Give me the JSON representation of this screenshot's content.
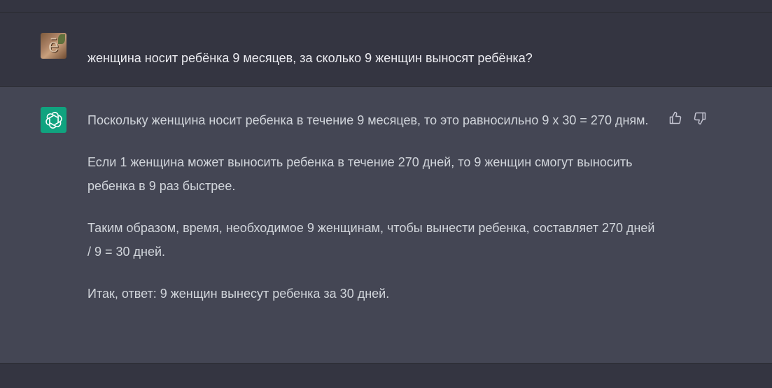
{
  "conversation": {
    "user_message": {
      "avatar": "user-photo-avatar",
      "avatar_glyph": "ē",
      "text": "женщина носит ребёнка 9 месяцев, за сколько 9 женщин выносят ребёнка?"
    },
    "assistant_message": {
      "avatar": "chatgpt-logo-icon",
      "avatar_color": "#10a37f",
      "paragraphs": [
        "Поскольку женщина носит ребенка в течение 9 месяцев, то это равносильно 9 x 30 = 270 дням.",
        "Если 1 женщина может выносить ребенка в течение 270 дней, то 9 женщин смогут выносить ребенка в 9 раз быстрее.",
        "Таким образом, время, необходимое 9 женщинам, чтобы вынести ребенка, составляет 270 дней / 9 = 30 дней.",
        "Итак, ответ: 9 женщин вынесут ребенка за 30 дней."
      ],
      "feedback_icons": [
        "thumbs-up-icon",
        "thumbs-down-icon"
      ]
    }
  },
  "colors": {
    "user_row_bg": "#343541",
    "assistant_row_bg": "#444654",
    "text": "#d1d5db",
    "accent": "#10a37f"
  }
}
